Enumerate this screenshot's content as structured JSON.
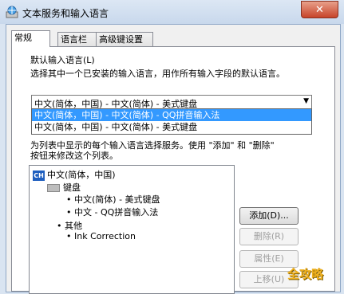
{
  "window": {
    "title": "文本服务和输入语言",
    "close_label": "✕",
    "app_icon": "keyboard-globe-icon"
  },
  "tabs": [
    {
      "label": "常规",
      "active": true
    },
    {
      "label": "语言栏",
      "active": false
    },
    {
      "label": "高级键设置",
      "active": false
    }
  ],
  "default_language": {
    "heading": "默认输入语言(L)",
    "description": "选择其中一个已安装的输入语言，用作所有输入字段的默认语言。",
    "selected": "中文(简体，中国) - 中文(简体) - 美式键盘",
    "options": [
      "中文(简体，中国) - 中文(简体) - QQ拼音输入法",
      "中文(简体，中国) - 中文(简体) - 美式键盘"
    ]
  },
  "installed_services": {
    "description_line1": "为列表中显示的每个输入语言选择服务。使用 \"添加\" 和 \"删除\"",
    "description_line2": "按钮来修改这个列表。",
    "tree": {
      "language": "中文(简体，中国)",
      "language_badge": "CH",
      "keyboard_group": "键盘",
      "keyboards": [
        "中文(简体) - 美式键盘",
        "中文 - QQ拼音输入法"
      ],
      "other_group": "其他",
      "others": [
        "Ink Correction"
      ]
    }
  },
  "buttons": {
    "add": "添加(D)...",
    "remove": "删除(R)",
    "properties": "属性(E)",
    "move_up": "上移(U)"
  },
  "watermark": "全攻略"
}
